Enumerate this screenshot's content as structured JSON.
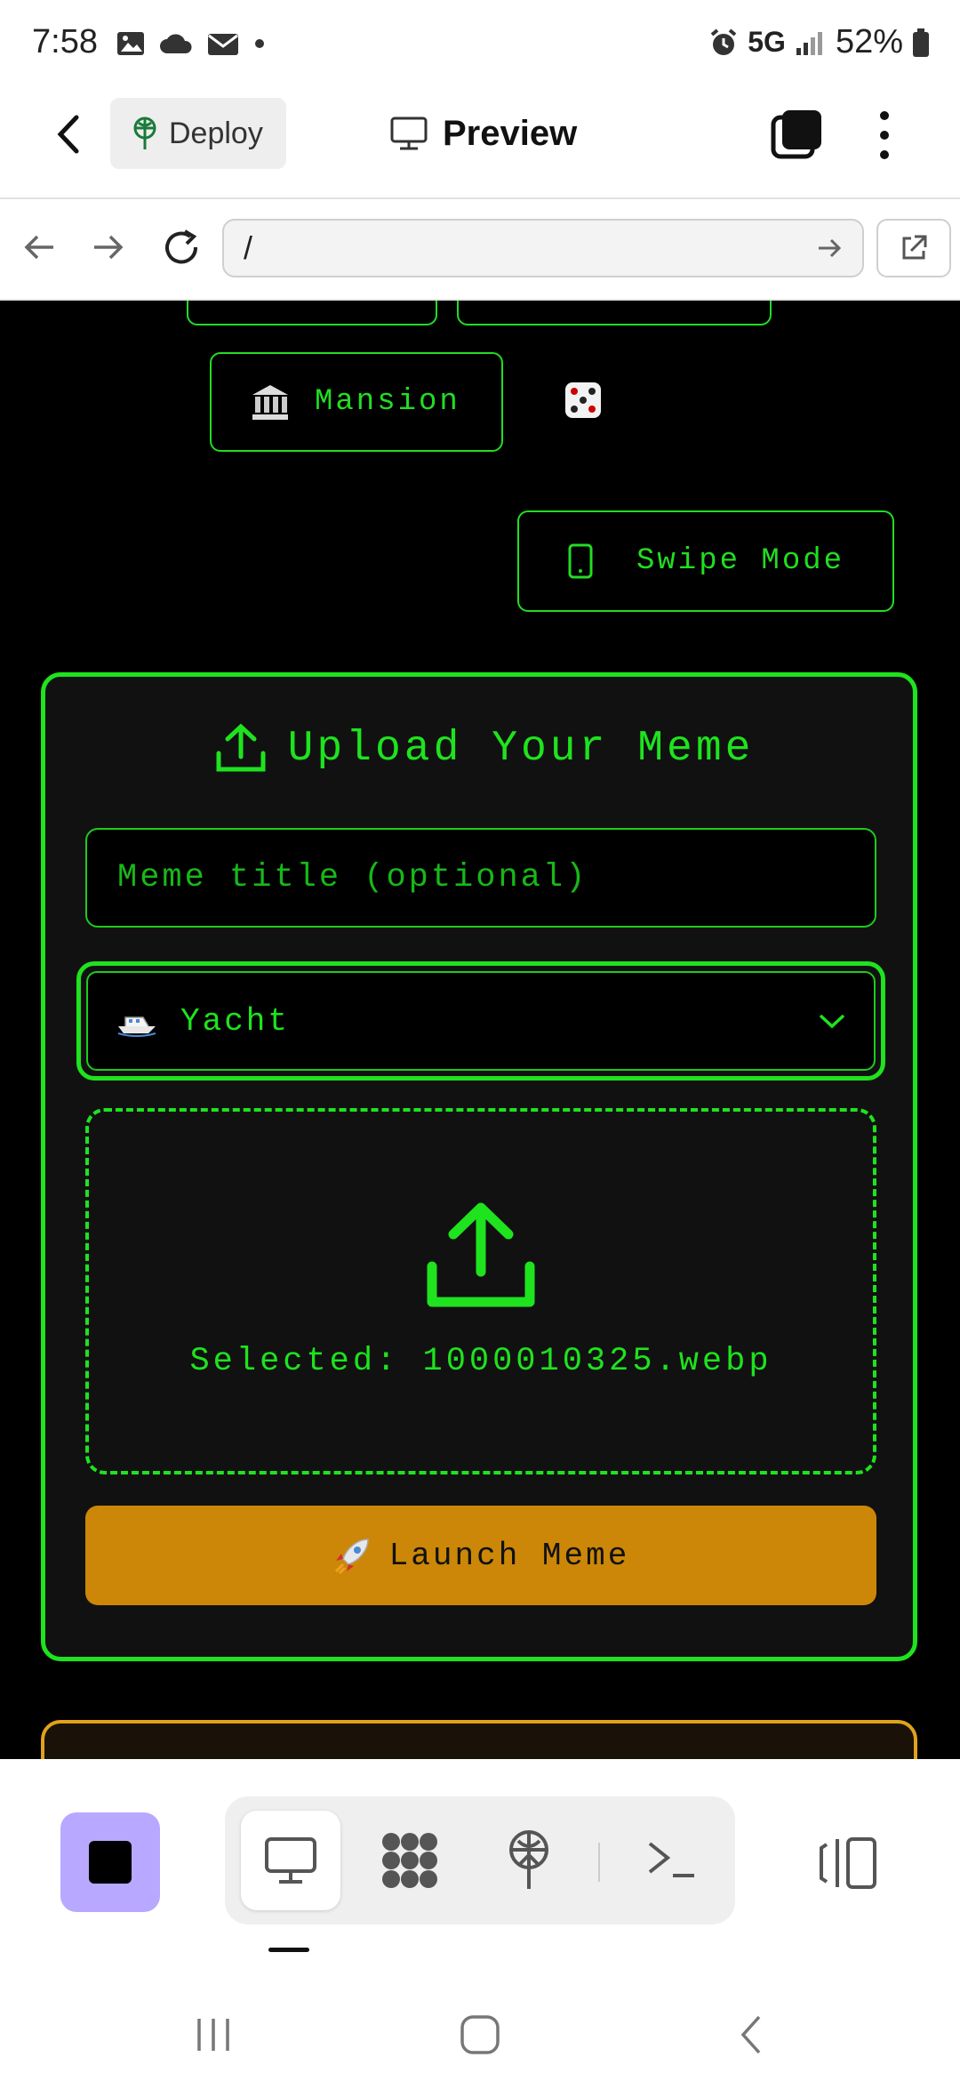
{
  "status_bar": {
    "time": "7:58",
    "network": "5G",
    "battery": "52%"
  },
  "app_bar": {
    "deploy_label": "Deploy",
    "preview_label": "Preview"
  },
  "browser": {
    "url": "/"
  },
  "page": {
    "mansion_label": "Mansion",
    "swipe_mode_label": "Swipe Mode",
    "upload_title": "Upload Your Meme",
    "title_placeholder": "Meme title (optional)",
    "category_selected": "Yacht",
    "selected_file_text": "Selected: 1000010325.webp",
    "launch_label": "Launch Meme"
  },
  "colors": {
    "neon_green": "#1ee31e",
    "launch_orange": "#cc8708",
    "stop_purple": "#b8a8ff"
  },
  "icons": [
    "back-arrow-icon",
    "antenna-icon",
    "monitor-icon",
    "layers-icon",
    "more-vert-icon",
    "forward-arrow-icon",
    "reload-icon",
    "go-arrow-icon",
    "external-link-icon",
    "bank-icon",
    "dice-icon",
    "phone-icon",
    "upload-icon",
    "yacht-icon",
    "chevron-down-icon",
    "rocket-icon",
    "stop-icon",
    "puzzle-icon",
    "terminal-icon",
    "panels-icon"
  ]
}
